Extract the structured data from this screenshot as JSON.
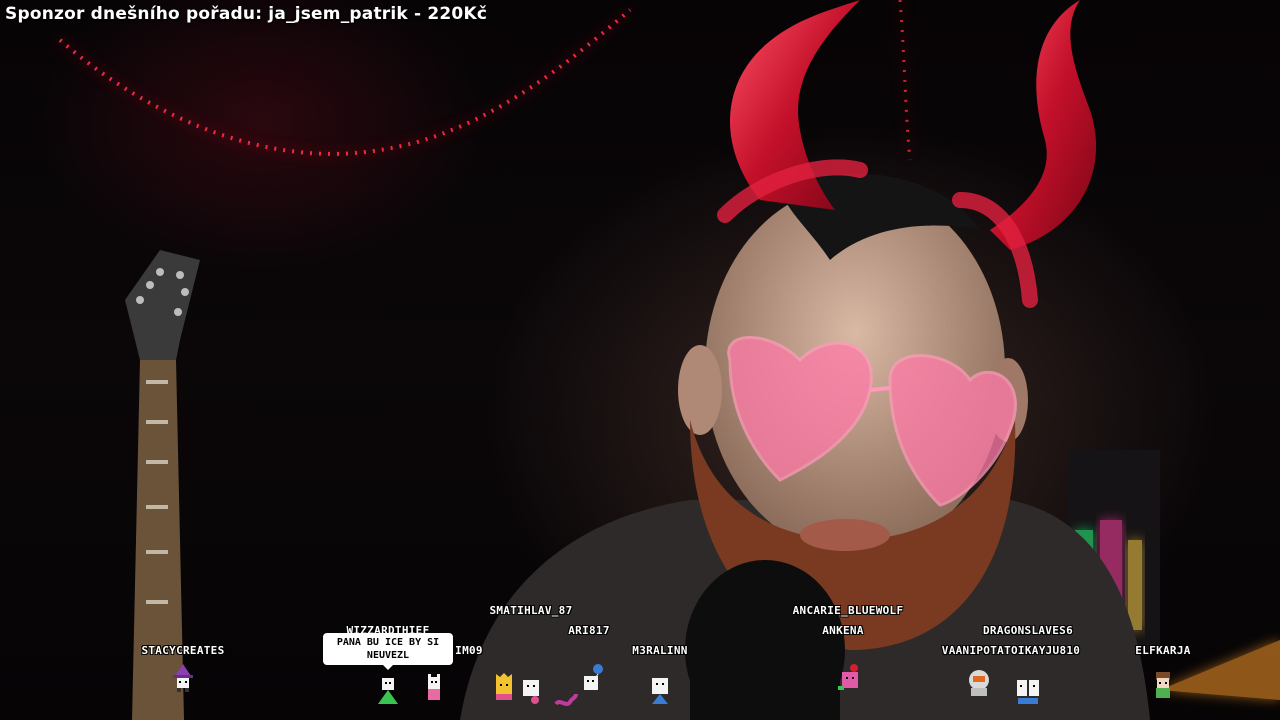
{
  "sponsor": {
    "text": "Sponzor dnešního pořadu: ja_jsem_patrik - 220Kč"
  },
  "chatters": [
    {
      "name": "STACYCREATES",
      "avatar": "witch-avatar-icon",
      "color": "#8b3fb0"
    },
    {
      "name": "WIZZARDTHIEF",
      "avatar": "green-blob-avatar-icon",
      "color": "#39c452"
    },
    {
      "name": "IM09",
      "avatar": "pink-cat-avatar-icon",
      "color": "#e86aa0"
    },
    {
      "name": "SMATIHLAV_87",
      "avatar": "crowned-avatar-icon",
      "color": "#f2c230"
    },
    {
      "name": "ARI817",
      "avatar": "balloon-cat-avatar-icon",
      "color": "#3a7bd5"
    },
    {
      "name": "M3RALINN",
      "avatar": "white-blob-avatar-icon",
      "color": "#ffffff"
    },
    {
      "name": "ANCARIE_BLUEWOLF",
      "avatar": "pink-blob-avatar-icon",
      "color": "#e05aa8"
    },
    {
      "name": "ANKENA",
      "avatar": "pink-blob-avatar-icon",
      "color": "#e05aa8"
    },
    {
      "name": "DRAGONSLAVES6",
      "avatar": "astronaut-avatar-icon",
      "color": "#d9d9d9"
    },
    {
      "name": "VAANIPOTATOIKAYJU810",
      "avatar": "white-blob-avatar-icon",
      "color": "#ffffff"
    },
    {
      "name": "ELFKARJA",
      "avatar": "elf-avatar-icon",
      "color": "#4fb04f"
    }
  ],
  "speech_bubble": {
    "text": "PANA BU ICE BY SI NEUVEZL"
  },
  "colors": {
    "neon_red": "#ff2a3c",
    "horn_red": "#d2142a",
    "glasses_pink": "#ff7aa8",
    "beard": "#7a3a22"
  }
}
